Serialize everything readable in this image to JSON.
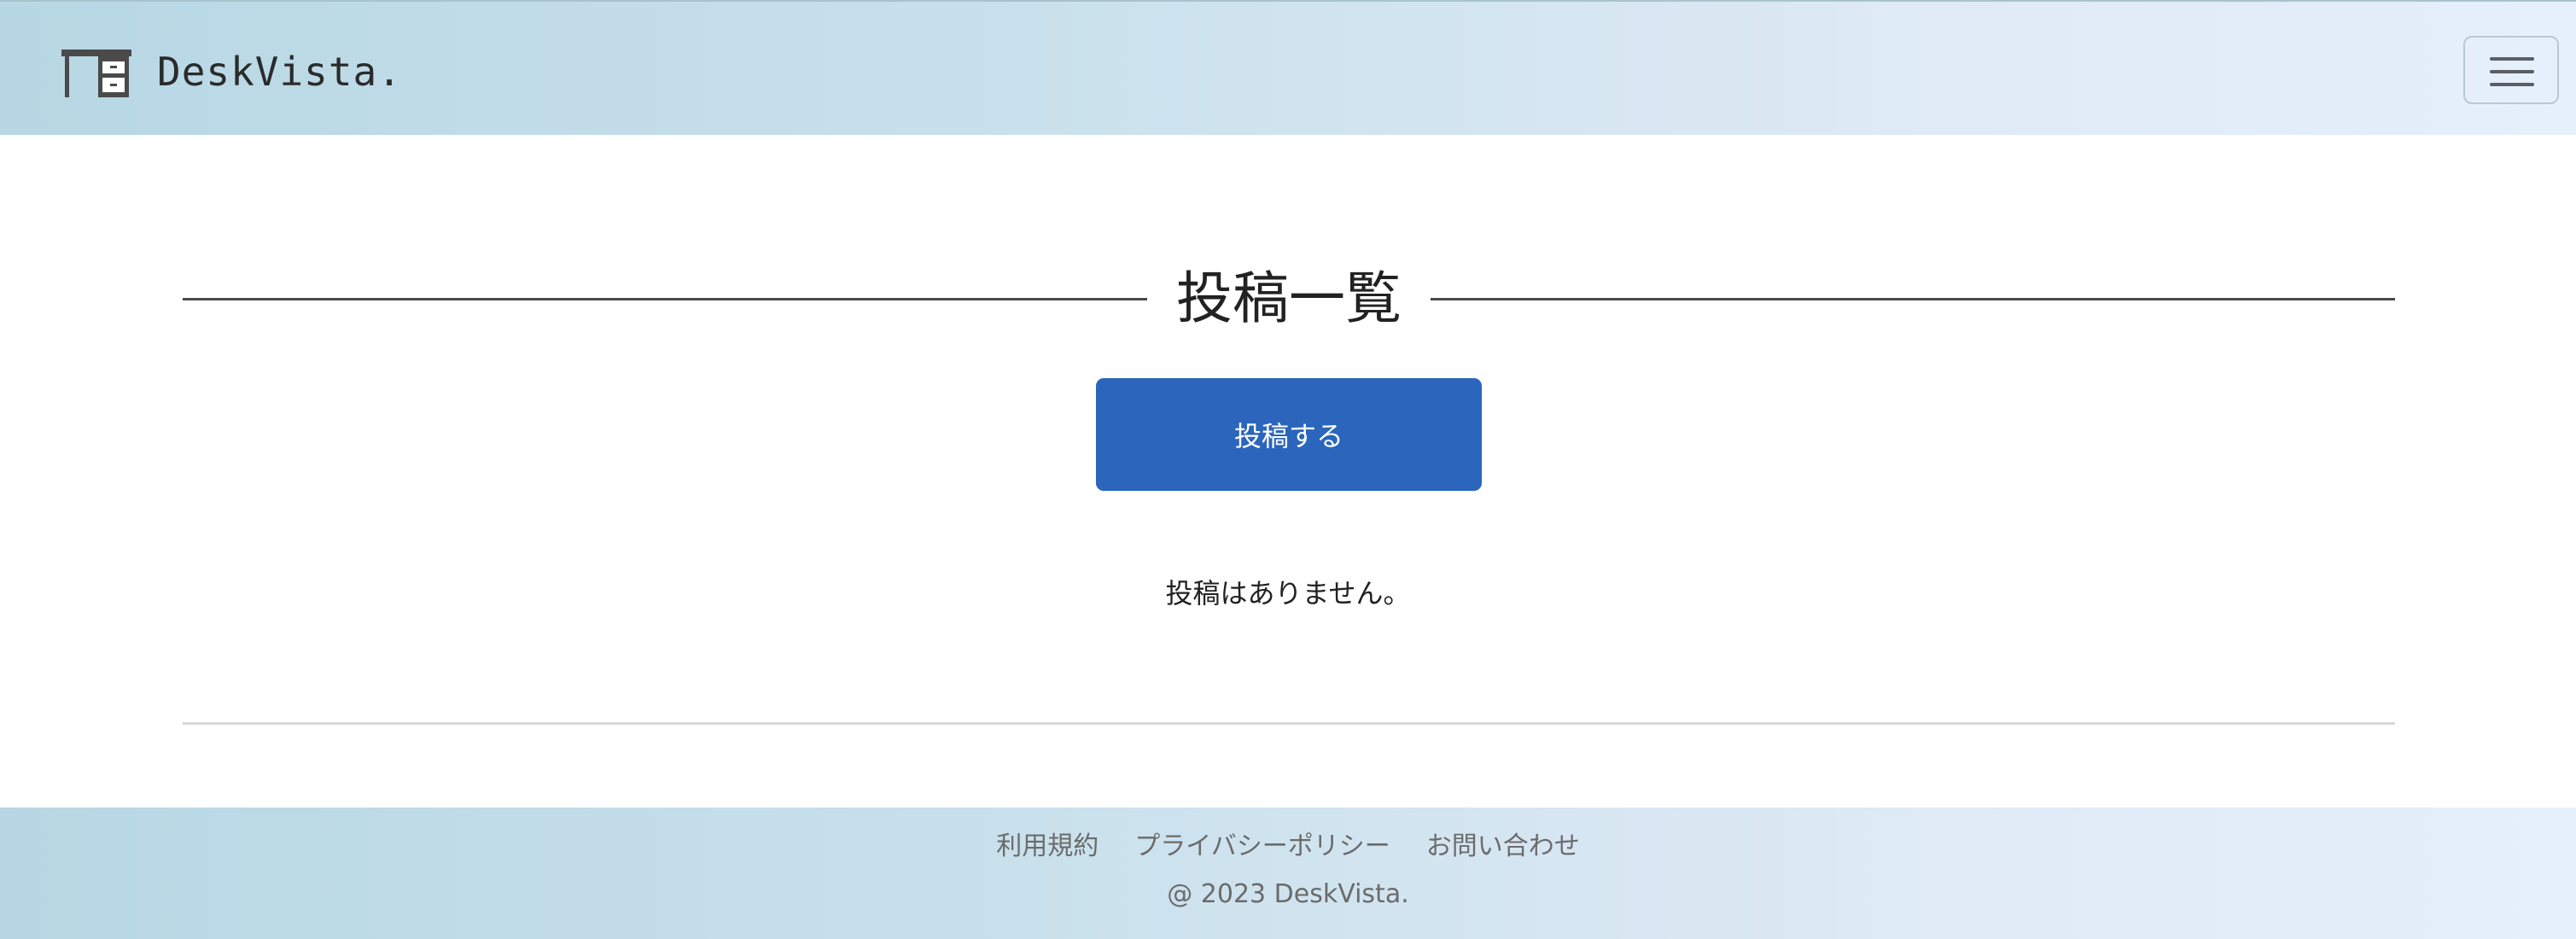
{
  "navbar": {
    "brand_name": "DeskVista.",
    "brand_icon": "desk-icon",
    "menu_icon": "hamburger-menu-icon"
  },
  "main": {
    "title": "投稿一覧",
    "post_button_label": "投稿する",
    "empty_message": "投稿はありません。"
  },
  "footer": {
    "links": [
      "利用規約",
      "プライバシーポリシー",
      "お問い合わせ"
    ],
    "copyright": "@ 2023 DeskVista."
  },
  "colors": {
    "primary_button": "#2b66bc",
    "brand_text": "#2b2b2b",
    "footer_text": "#6b6b6b"
  }
}
